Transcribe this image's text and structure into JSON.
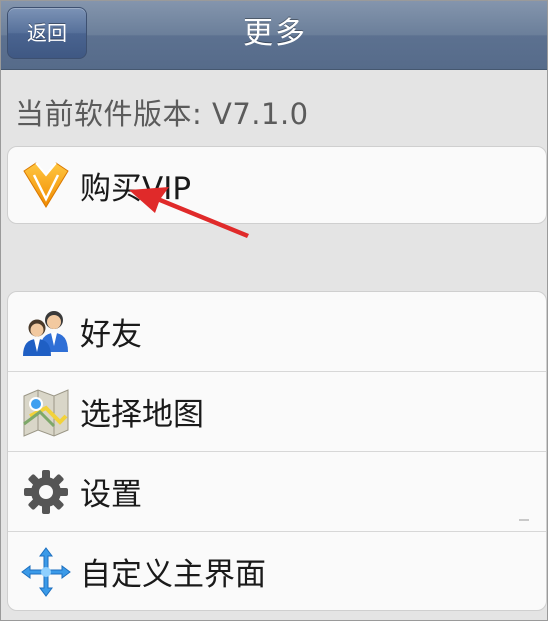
{
  "header": {
    "back_label": "返回",
    "title": "更多"
  },
  "version_text": "当前软件版本: V7.1.0",
  "vip_item": {
    "label": "购买VIP",
    "icon": "vip-diamond-icon"
  },
  "menu_items": [
    {
      "label": "好友",
      "icon": "friends-icon"
    },
    {
      "label": "选择地图",
      "icon": "map-icon"
    },
    {
      "label": "设置",
      "icon": "gear-icon"
    },
    {
      "label": "自定义主界面",
      "icon": "custom-arrows-icon"
    }
  ],
  "colors": {
    "titlebar": "#6b7f9a",
    "background": "#e4e4e4",
    "annotation_arrow": "#e02a2a",
    "vip_icon": "#f5a623"
  }
}
